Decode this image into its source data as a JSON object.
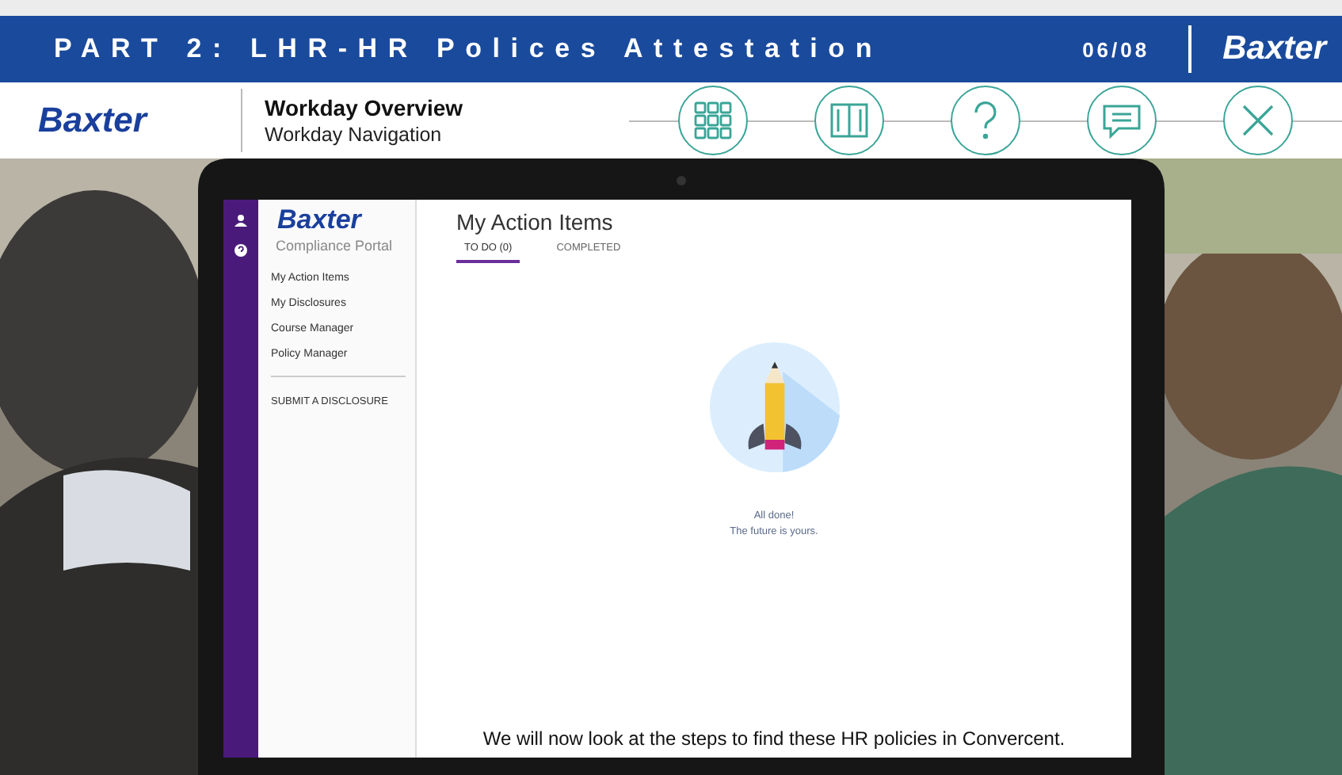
{
  "header": {
    "title": "PART 2: LHR-HR Polices Attestation",
    "counter": "06/08",
    "logo": "Baxter"
  },
  "nav": {
    "logo": "Baxter",
    "title": "Workday Overview",
    "subtitle": "Workday Navigation",
    "buttons": [
      {
        "kind": "menu"
      },
      {
        "kind": "book"
      },
      {
        "kind": "help"
      },
      {
        "kind": "chat"
      },
      {
        "kind": "close"
      }
    ]
  },
  "portal": {
    "logo": "Baxter",
    "subtitle": "Compliance Portal",
    "menu": [
      {
        "label": "My Action Items"
      },
      {
        "label": "My Disclosures"
      },
      {
        "label": "Course Manager"
      },
      {
        "label": "Policy Manager"
      }
    ],
    "action": "SUBMIT A DISCLOSURE",
    "heading": "My Action Items",
    "tabs": [
      {
        "label": "TO DO (0)",
        "selected": true
      },
      {
        "label": "COMPLETED",
        "selected": false
      }
    ],
    "empty": [
      "All done!",
      "The future is yours."
    ]
  },
  "caption": "We will now look at the steps to find these HR policies in Convercent."
}
